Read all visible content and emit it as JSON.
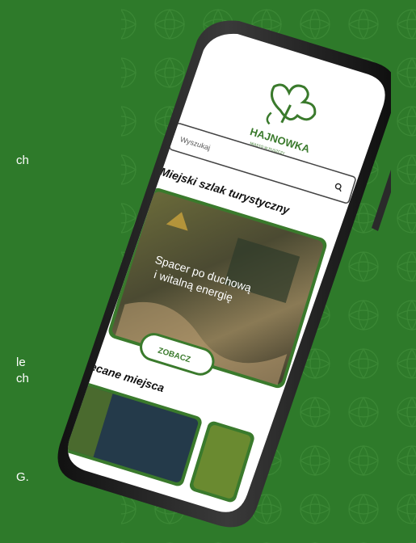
{
  "side_text": {
    "line1": "ch",
    "line2": "le",
    "line3": "ch",
    "line4": "G."
  },
  "app": {
    "logo_text": "HAJNOWKA",
    "logo_subtitle": "MIASTO W PUSZCZY",
    "search_placeholder": "Wyszukaj",
    "section1_title": "Miejski szlak turystyczny",
    "hero_line1": "Spacer po duchową",
    "hero_line2": "i witalną energię",
    "cta_label": "ZOBACZ",
    "section2_title": "Polecane miejsca"
  },
  "colors": {
    "background": "#2e7a2a",
    "brand_green": "#3a7a2c",
    "phone_frame": "#1c1c1c",
    "screen": "#ffffff"
  }
}
